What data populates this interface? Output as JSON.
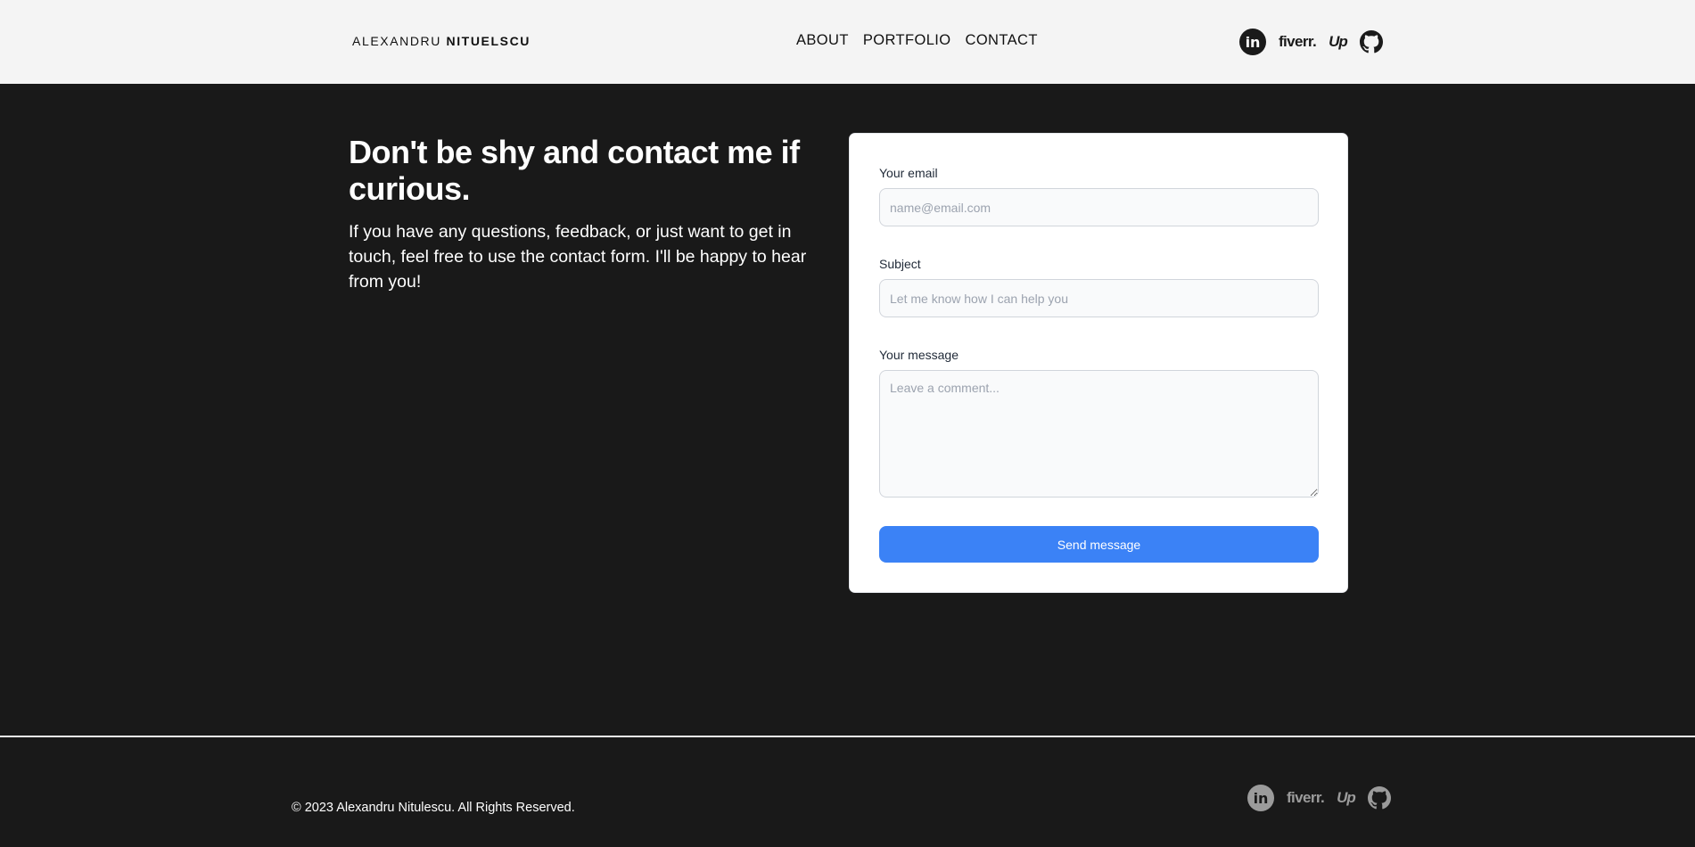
{
  "header": {
    "brand_first": "ALEXANDRU",
    "brand_last": "NITUELSCU",
    "nav": [
      {
        "label": "ABOUT"
      },
      {
        "label": "PORTFOLIO"
      },
      {
        "label": "CONTACT"
      }
    ],
    "social": {
      "linkedin": "in",
      "fiverr": "fiverr.",
      "upwork": "Up",
      "github_icon": "github-icon"
    }
  },
  "main": {
    "title": "Don't be shy and contact me if curious.",
    "text": "If you have any questions, feedback, or just want to get in touch, feel free to use the contact form. I'll be happy to hear from you!"
  },
  "form": {
    "email_label": "Your email",
    "email_placeholder": "name@email.com",
    "subject_label": "Subject",
    "subject_placeholder": "Let me know how I can help you",
    "message_label": "Your message",
    "message_placeholder": "Leave a comment...",
    "submit_label": "Send message",
    "accent": "#3b82f6"
  },
  "footer": {
    "copyright": "© 2023 Alexandru Nitulescu. All Rights Reserved.",
    "social": {
      "linkedin": "in",
      "fiverr": "fiverr.",
      "upwork": "Up",
      "github_icon": "github-icon"
    }
  }
}
